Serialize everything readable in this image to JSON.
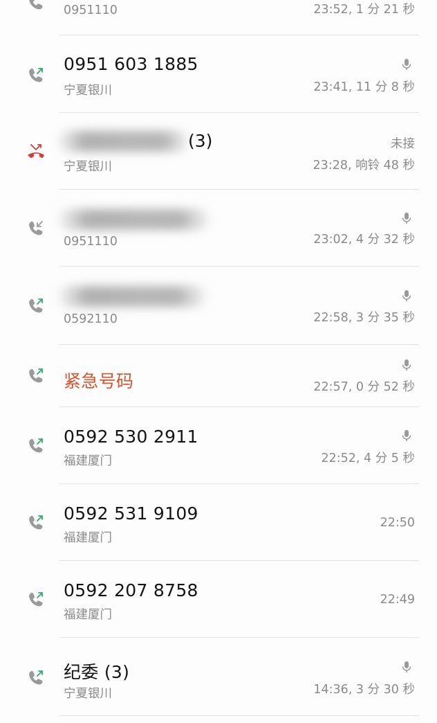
{
  "calls": [
    {
      "name": "",
      "sub": "0951110",
      "meta": "23:52, 1 分 21 秒",
      "icon": "outgoing-call-icon",
      "recorded": false
    },
    {
      "name": "0951 603 1885",
      "sub": "宁夏银川",
      "meta": "23:41, 11 分 8 秒",
      "icon": "outgoing-call-icon",
      "recorded": true
    },
    {
      "name": "",
      "suffix": "(3)",
      "sub": "宁夏银川",
      "meta": "23:28, 响铃 48 秒",
      "status": "未接",
      "icon": "missed-call-icon",
      "recorded": false
    },
    {
      "name": "",
      "sub": "0951110",
      "meta": "23:02, 4 分 32 秒",
      "icon": "incoming-call-icon",
      "recorded": true
    },
    {
      "name": "",
      "sub": "0592110",
      "meta": "22:58, 3 分 35 秒",
      "icon": "outgoing-call-icon",
      "recorded": true
    },
    {
      "name": "紧急号码",
      "sub": "",
      "meta": "22:57, 0 分 52 秒",
      "icon": "outgoing-call-icon",
      "recorded": true
    },
    {
      "name": "0592 530 2911",
      "sub": "福建厦门",
      "meta": "22:52, 4 分 5 秒",
      "icon": "outgoing-call-icon",
      "recorded": true
    },
    {
      "name": "0592 531 9109",
      "sub": "福建厦门",
      "meta": "22:50",
      "icon": "outgoing-call-icon",
      "recorded": false
    },
    {
      "name": "0592 207 8758",
      "sub": "福建厦门",
      "meta": "22:49",
      "icon": "outgoing-call-icon",
      "recorded": false
    },
    {
      "name": "纪委 (3)",
      "sub": "宁夏银川",
      "meta": "14:36, 3 分 30 秒",
      "icon": "outgoing-call-icon",
      "recorded": true
    }
  ],
  "colors": {
    "outgoing_arrow": "#2fae6a",
    "missed": "#d33d3d",
    "phone_gray": "#9a9a9a",
    "emergency_text": "#d9552f"
  }
}
